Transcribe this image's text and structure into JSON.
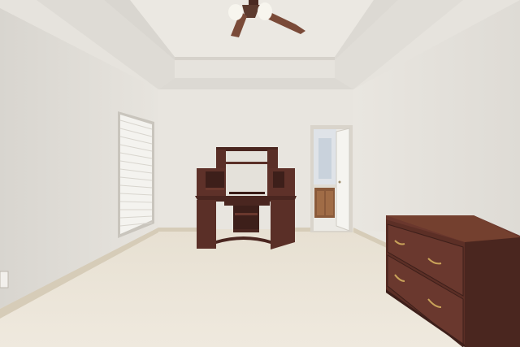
{
  "scene": {
    "description_label": "",
    "colors": {
      "wall": "#e6e3dd",
      "wall_shade": "#d9d5ce",
      "ceiling": "#ebe8e2",
      "carpet": "#e9e1d2",
      "trim": "#d8cdb9",
      "wood": "#5a2f27",
      "wood_dark": "#3f1f1a",
      "brass": "#c9a35a"
    }
  }
}
